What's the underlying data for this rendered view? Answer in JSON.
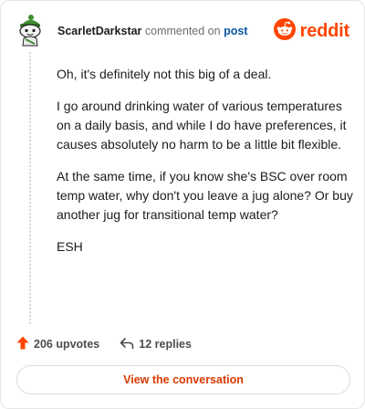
{
  "header": {
    "username": "ScarletDarkstar",
    "action_text": "commented on",
    "post_link": "post",
    "brand": "reddit"
  },
  "comment": {
    "paragraphs": [
      "Oh, it's definitely not this big of a deal.",
      "I go around drinking water of various temperatures on a daily basis, and while I do have preferences, it causes absolutely no harm to be a little bit flexible.",
      "At the same time, if you know she's BSC over room temp water, why don't you leave a jug alone? Or buy another jug for transitional temp water?",
      "ESH"
    ]
  },
  "stats": {
    "upvotes": "206 upvotes",
    "replies": "12 replies"
  },
  "cta_label": "View the conversation",
  "colors": {
    "brand": "#ff4500",
    "upvote": "#ff4500",
    "link": "#0b57a4",
    "cta_text": "#d93900"
  },
  "icons": {
    "avatar": "snoo-avatar-icon",
    "logo": "reddit-logo-icon",
    "upvote": "upvote-arrow-icon",
    "reply": "reply-arrow-icon"
  }
}
